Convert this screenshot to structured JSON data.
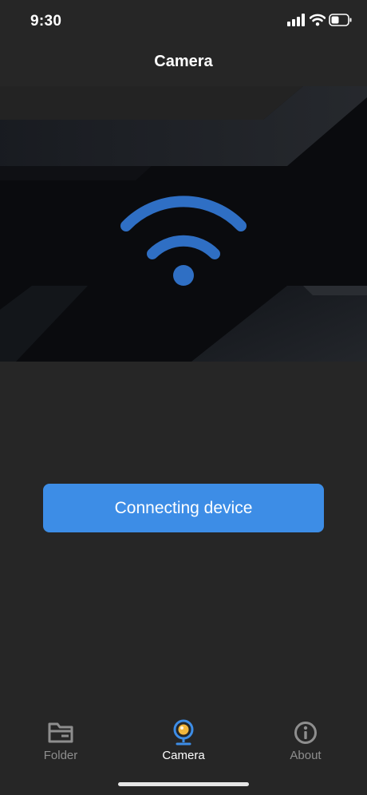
{
  "status_bar": {
    "time": "9:30",
    "icons": [
      "cellular-signal-icon",
      "wifi-icon",
      "battery-icon"
    ]
  },
  "header": {
    "title": "Camera"
  },
  "hero": {
    "icon": "wifi-icon",
    "icon_color": "#2f6fc4",
    "background_color": "#0a0b0e"
  },
  "main": {
    "connect_button_label": "Connecting device",
    "button_color": "#3d8de6"
  },
  "tab_bar": {
    "active_tab": "Camera",
    "active_color": "#3d8de6",
    "items": [
      {
        "label": "Folder",
        "icon": "folder-icon"
      },
      {
        "label": "Camera",
        "icon": "webcam-icon"
      },
      {
        "label": "About",
        "icon": "info-icon"
      }
    ]
  },
  "colors": {
    "page_background": "#262626"
  }
}
